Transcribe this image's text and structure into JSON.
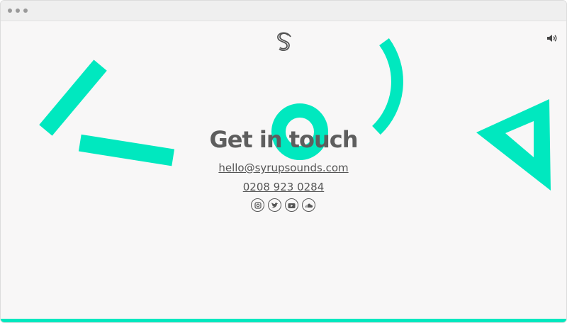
{
  "window": {
    "controls": [
      "close",
      "minimize",
      "maximize"
    ]
  },
  "brand": {
    "logo_icon": "s-monogram-logo-icon"
  },
  "sound": {
    "icon": "speaker-icon"
  },
  "main": {
    "heading": "Get in touch",
    "email": "hello@syrupsounds.com",
    "phone": "0208 923 0284"
  },
  "social": [
    {
      "icon": "instagram-icon"
    },
    {
      "icon": "twitter-icon"
    },
    {
      "icon": "youtube-icon"
    },
    {
      "icon": "soundcloud-icon"
    }
  ],
  "colors": {
    "accent": "#00e8bf",
    "text": "#5e5e5e",
    "background": "#f8f7f7"
  }
}
